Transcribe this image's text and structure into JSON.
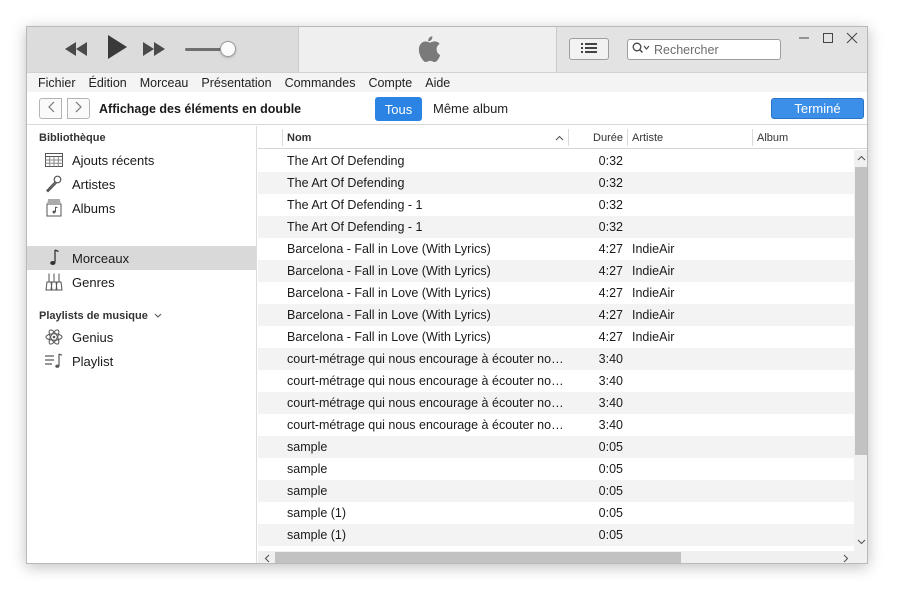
{
  "menu": [
    "Fichier",
    "Édition",
    "Morceau",
    "Présentation",
    "Commandes",
    "Compte",
    "Aide"
  ],
  "search": {
    "placeholder": "Rechercher"
  },
  "toolbar": {
    "title": "Affichage des éléments en double",
    "seg_all": "Tous",
    "seg_album": "Même album",
    "done": "Terminé"
  },
  "sidebar": {
    "library_heading": "Bibliothèque",
    "library_items": [
      {
        "label": "Ajouts récents",
        "icon": "grid-calendar-icon"
      },
      {
        "label": "Artistes",
        "icon": "microphone-icon"
      },
      {
        "label": "Albums",
        "icon": "album-icon"
      },
      {
        "label": "Morceaux",
        "icon": "music-note-icon",
        "selected": true
      },
      {
        "label": "Genres",
        "icon": "guitar-icon"
      }
    ],
    "playlists_heading": "Playlists de musique",
    "playlist_items": [
      {
        "label": "Genius",
        "icon": "atom-icon"
      },
      {
        "label": "Playlist",
        "icon": "playlist-icon"
      }
    ]
  },
  "table": {
    "columns": {
      "name": "Nom",
      "duration": "Durée",
      "artist": "Artiste",
      "album": "Album"
    },
    "rows": [
      {
        "name": "The Art Of Defending",
        "duration": "0:32",
        "artist": ""
      },
      {
        "name": "The Art Of Defending",
        "duration": "0:32",
        "artist": ""
      },
      {
        "name": "The Art Of Defending - 1",
        "duration": "0:32",
        "artist": ""
      },
      {
        "name": "The Art Of Defending - 1",
        "duration": "0:32",
        "artist": ""
      },
      {
        "name": "Barcelona - Fall in Love (With Lyrics)",
        "duration": "4:27",
        "artist": "IndieAir"
      },
      {
        "name": "Barcelona - Fall in Love (With Lyrics)",
        "duration": "4:27",
        "artist": "IndieAir"
      },
      {
        "name": "Barcelona - Fall in Love (With Lyrics)",
        "duration": "4:27",
        "artist": "IndieAir"
      },
      {
        "name": "Barcelona - Fall in Love (With Lyrics)",
        "duration": "4:27",
        "artist": "IndieAir"
      },
      {
        "name": "Barcelona - Fall in Love (With Lyrics)",
        "duration": "4:27",
        "artist": "IndieAir"
      },
      {
        "name": "court-métrage qui nous encourage à écouter nos...",
        "duration": "3:40",
        "artist": ""
      },
      {
        "name": "court-métrage qui nous encourage à écouter nos...",
        "duration": "3:40",
        "artist": ""
      },
      {
        "name": "court-métrage qui nous encourage à écouter nos...",
        "duration": "3:40",
        "artist": ""
      },
      {
        "name": "court-métrage qui nous encourage à écouter nos...",
        "duration": "3:40",
        "artist": ""
      },
      {
        "name": "sample",
        "duration": "0:05",
        "artist": ""
      },
      {
        "name": "sample",
        "duration": "0:05",
        "artist": ""
      },
      {
        "name": "sample",
        "duration": "0:05",
        "artist": ""
      },
      {
        "name": "sample (1)",
        "duration": "0:05",
        "artist": ""
      },
      {
        "name": "sample (1)",
        "duration": "0:05",
        "artist": ""
      }
    ]
  },
  "colors": {
    "accent": "#2b84e3",
    "selected_row": "#d9d9d9"
  }
}
